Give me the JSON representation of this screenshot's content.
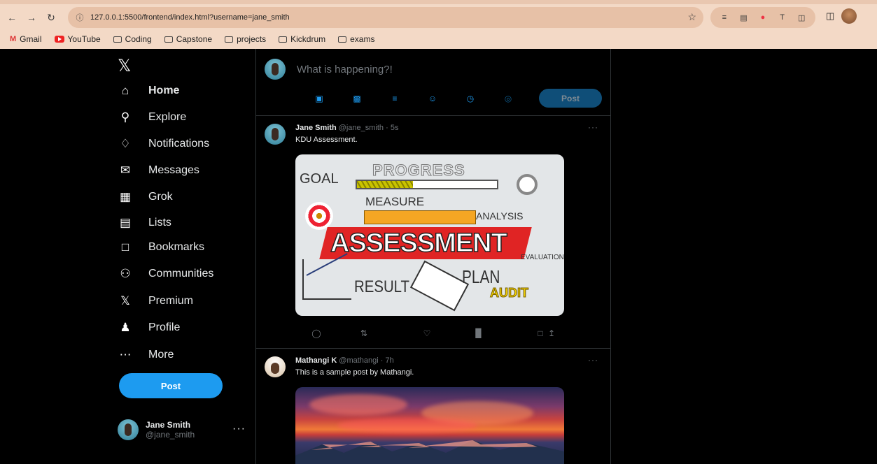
{
  "browser": {
    "url": "127.0.0.1:5500/frontend/index.html?username=jane_smith",
    "bookmarks": [
      "Gmail",
      "YouTube",
      "Coding",
      "Capstone",
      "projects",
      "Kickdrum",
      "exams"
    ]
  },
  "sidebar": {
    "nav": [
      {
        "label": "Home",
        "icon": "home-icon"
      },
      {
        "label": "Explore",
        "icon": "search-icon"
      },
      {
        "label": "Notifications",
        "icon": "bell-icon"
      },
      {
        "label": "Messages",
        "icon": "mail-icon"
      },
      {
        "label": "Grok",
        "icon": "grok-icon"
      },
      {
        "label": "Lists",
        "icon": "list-icon"
      },
      {
        "label": "Bookmarks",
        "icon": "bookmark-icon"
      },
      {
        "label": "Communities",
        "icon": "people-icon"
      },
      {
        "label": "Premium",
        "icon": "x-logo-icon"
      },
      {
        "label": "Profile",
        "icon": "person-icon"
      },
      {
        "label": "More",
        "icon": "more-circle-icon"
      }
    ],
    "post_label": "Post",
    "user": {
      "name": "Jane Smith",
      "handle": "@jane_smith"
    }
  },
  "compose": {
    "placeholder": "What is happening?!",
    "post_label": "Post"
  },
  "posts": [
    {
      "name": "Jane Smith",
      "meta": "@jane_smith · 5s",
      "text": "KDU Assessment.",
      "image": {
        "words": [
          "GOAL",
          "PROGRESS",
          "MEASURE",
          "ANALYSIS",
          "ASSESSMENT",
          "EVALUATION",
          "RESULT",
          "PLAN",
          "AUDIT"
        ]
      }
    },
    {
      "name": "Mathangi K",
      "meta": "@mathangi · 7h",
      "text": "This is a sample post by Mathangi."
    }
  ],
  "colors": {
    "accent": "#1d9bf0",
    "background": "#000000",
    "border": "#2f3336",
    "muted": "#71767b"
  }
}
